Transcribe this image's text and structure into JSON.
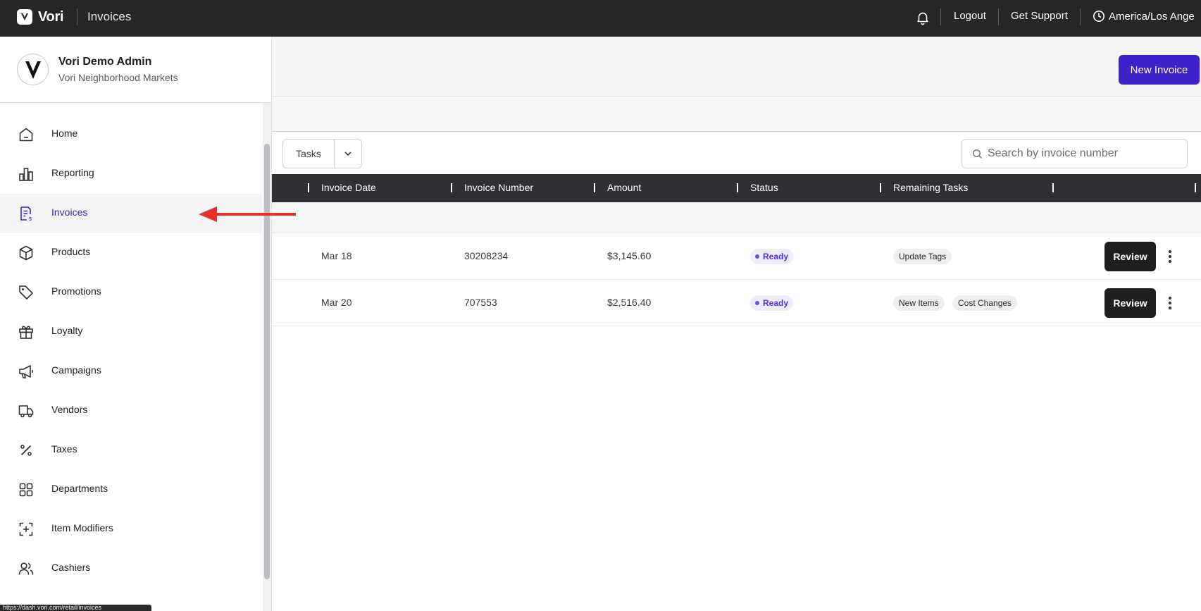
{
  "topbar": {
    "brand": "Vori",
    "title": "Invoices",
    "logout": "Logout",
    "support": "Get Support",
    "timezone": "America/Los Ange"
  },
  "sidebar": {
    "profile": {
      "name": "Vori Demo Admin",
      "org": "Vori Neighborhood Markets"
    },
    "items": [
      {
        "label": "Home",
        "icon": "home-icon"
      },
      {
        "label": "Reporting",
        "icon": "chart-icon"
      },
      {
        "label": "Invoices",
        "icon": "invoice-icon",
        "active": true
      },
      {
        "label": "Products",
        "icon": "box-icon"
      },
      {
        "label": "Promotions",
        "icon": "tag-icon"
      },
      {
        "label": "Loyalty",
        "icon": "gift-icon"
      },
      {
        "label": "Campaigns",
        "icon": "megaphone-icon"
      },
      {
        "label": "Vendors",
        "icon": "truck-icon"
      },
      {
        "label": "Taxes",
        "icon": "percent-icon"
      },
      {
        "label": "Departments",
        "icon": "grid-icon"
      },
      {
        "label": "Item Modifiers",
        "icon": "modifier-icon"
      },
      {
        "label": "Cashiers",
        "icon": "users-icon"
      }
    ],
    "status_url": "https://dash.vori.com/retail/invoices"
  },
  "main": {
    "new_invoice": "New Invoice",
    "filter_tasks": "Tasks",
    "search_placeholder": "Search by invoice number",
    "columns": [
      "Invoice Date",
      "Invoice Number",
      "Amount",
      "Status",
      "Remaining Tasks"
    ],
    "rows": [
      {
        "date": "Mar 18",
        "number": "30208234",
        "amount": "$3,145.60",
        "status": "Ready",
        "tasks": [
          "Update Tags"
        ],
        "action": "Review"
      },
      {
        "date": "Mar 20",
        "number": "707553",
        "amount": "$2,516.40",
        "status": "Ready",
        "tasks": [
          "New Items",
          "Cost Changes"
        ],
        "action": "Review"
      }
    ]
  },
  "colors": {
    "accent": "#3d21c9",
    "topbar": "#262626",
    "annotation_arrow": "#e8302a"
  }
}
